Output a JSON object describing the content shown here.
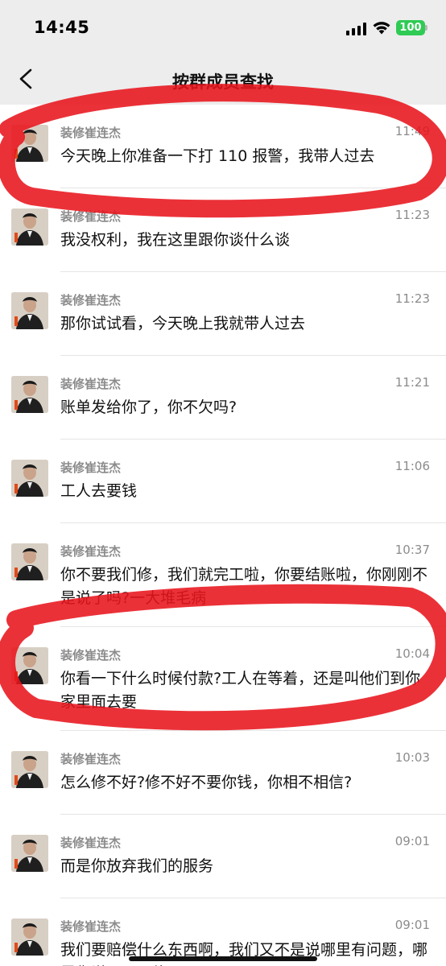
{
  "status_bar": {
    "time": "14:45",
    "battery": "100"
  },
  "header": {
    "title": "按群成员查找",
    "back_icon": "chevron-left-icon"
  },
  "messages": [
    {
      "sender": "装修崔连杰",
      "time": "11:49",
      "text": "今天晚上你准备一下打 110 报警，我带人过去"
    },
    {
      "sender": "装修崔连杰",
      "time": "11:23",
      "text": "我没权利，我在这里跟你谈什么谈"
    },
    {
      "sender": "装修崔连杰",
      "time": "11:23",
      "text": "那你试试看，今天晚上我就带人过去"
    },
    {
      "sender": "装修崔连杰",
      "time": "11:21",
      "text": "账单发给你了，你不欠吗?"
    },
    {
      "sender": "装修崔连杰",
      "time": "11:06",
      "text": "工人去要钱"
    },
    {
      "sender": "装修崔连杰",
      "time": "10:37",
      "text": "你不要我们修，我们就完工啦，你要结账啦，你刚刚不是说了吗?一大堆毛病"
    },
    {
      "sender": "装修崔连杰",
      "time": "10:04",
      "text": "你看一下什么时候付款?工人在等着，还是叫他们到你家里面去要"
    },
    {
      "sender": "装修崔连杰",
      "time": "10:03",
      "text": "怎么修不好?修不好不要你钱，你相不相信?"
    },
    {
      "sender": "装修崔连杰",
      "time": "09:01",
      "text": "而是你放弃我们的服务"
    },
    {
      "sender": "装修崔连杰",
      "time": "09:01",
      "text": "我们要赔偿什么东西啊，我们又不是说哪里有问题，哪里你说一下再修理"
    }
  ],
  "colors": {
    "accent_annotation": "#e8141c",
    "battery": "#2fcb55",
    "header_bg": "#ededed"
  }
}
